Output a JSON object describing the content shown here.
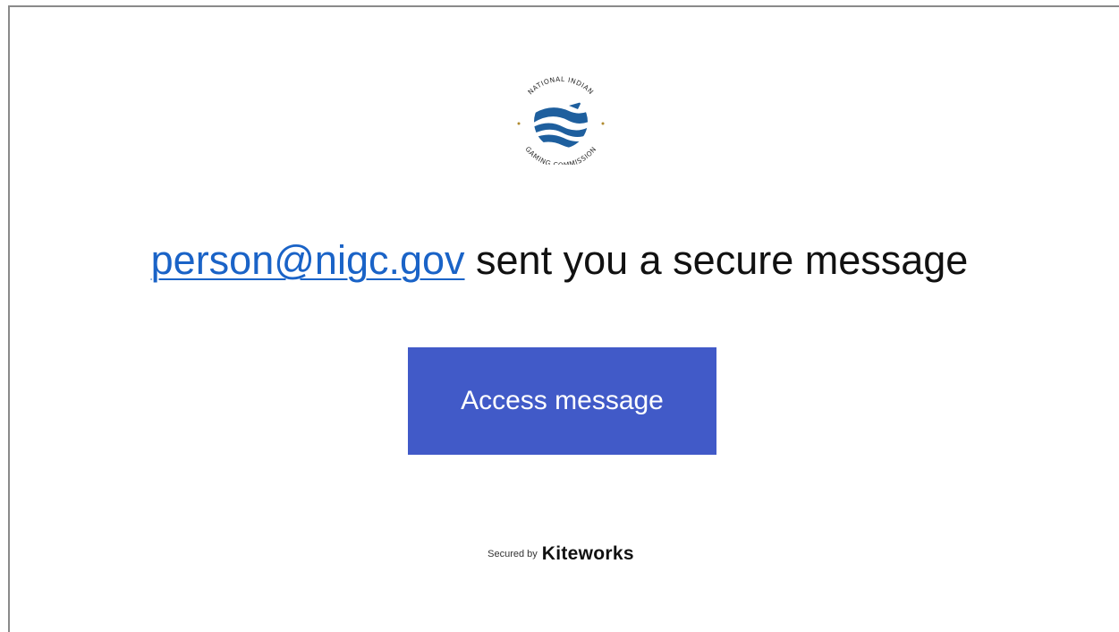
{
  "email": {
    "sender": "person@nigc.gov",
    "message_text": " sent you a secure message"
  },
  "logo": {
    "top_text": "NATIONAL INDIAN",
    "bottom_text": "GAMING COMMISSION"
  },
  "cta": {
    "label": "Access message"
  },
  "footer": {
    "secured_by": "Secured by",
    "brand": "Kiteworks"
  },
  "colors": {
    "link": "#1a63c7",
    "button": "#415ac8",
    "logo_blue": "#1e5f9e"
  }
}
